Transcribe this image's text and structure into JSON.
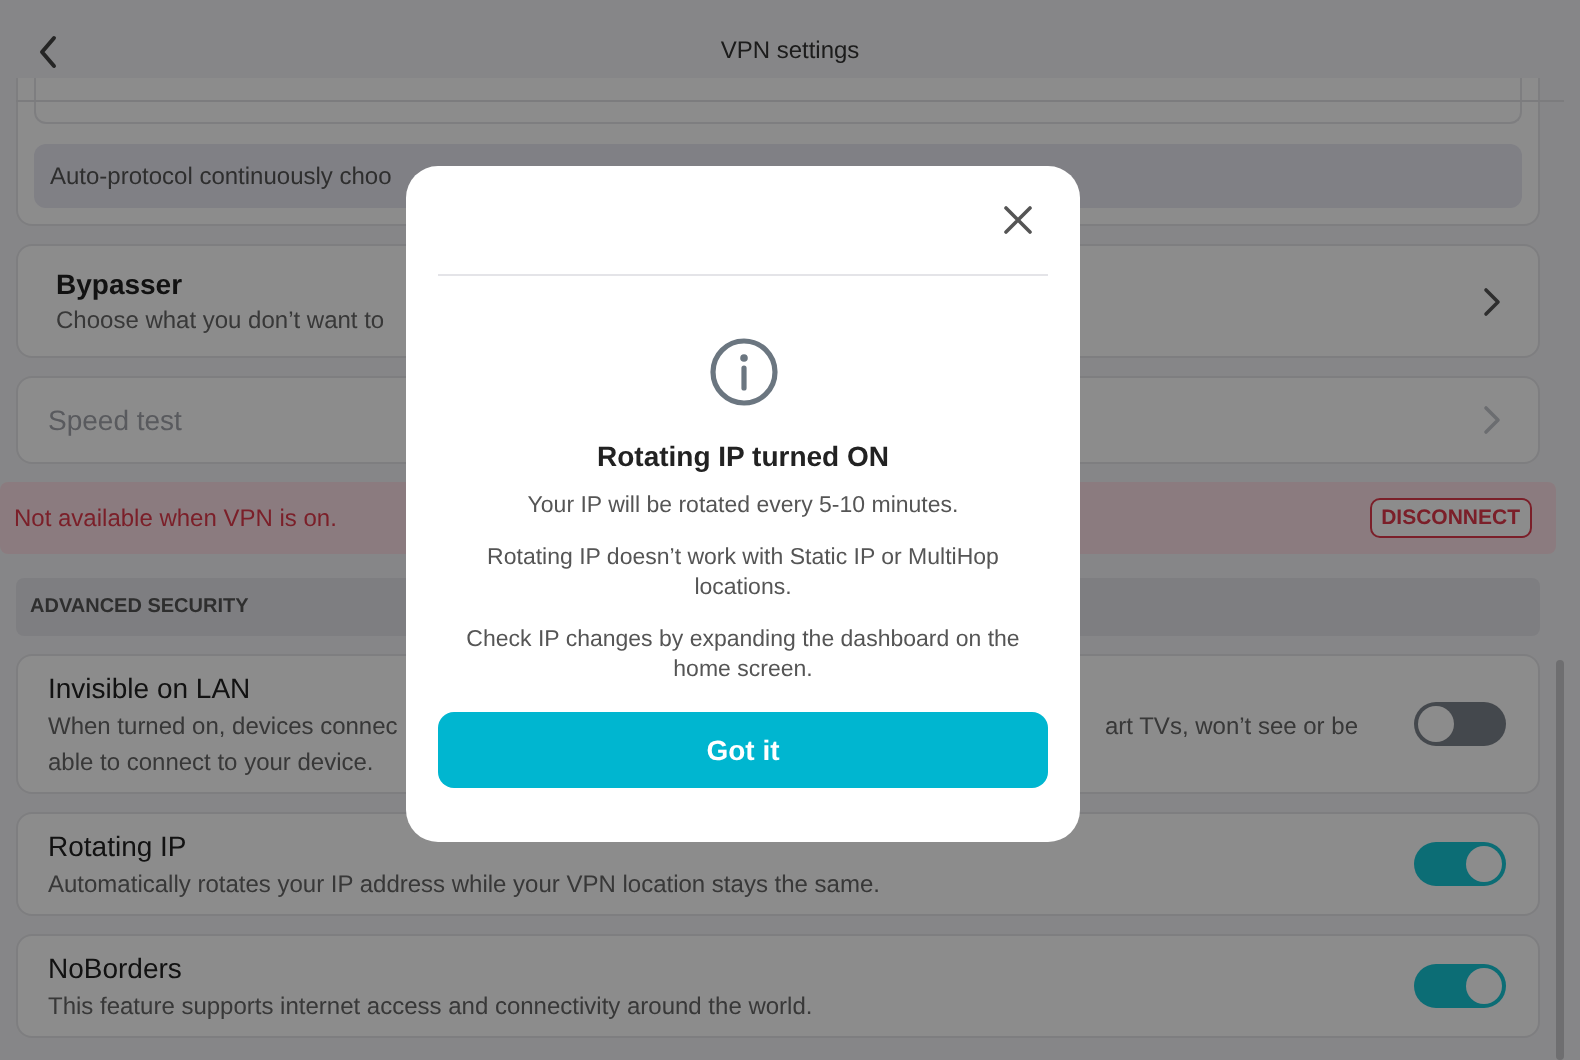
{
  "header": {
    "title": "VPN settings"
  },
  "protocol_note": {
    "text": "Auto-protocol continuously choo"
  },
  "items": [
    {
      "kind": "link",
      "title": "Bypasser",
      "description": "Choose what you don’t want to",
      "disabled": false
    },
    {
      "kind": "link",
      "title": "Speed test",
      "disabled": true
    }
  ],
  "notice": {
    "text": "Not available when VPN is on.",
    "button": "DISCONNECT"
  },
  "section": {
    "title": "ADVANCED SECURITY",
    "settings": [
      {
        "title": "Invisible on LAN",
        "description_lines": [
          [
            "When turned on, devices connec",
            "art TVs, won’t see or be"
          ],
          [
            "able to connect to your device."
          ]
        ],
        "on": false
      },
      {
        "title": "Rotating IP",
        "description_lines": [
          [
            "Automatically rotates your IP address while your VPN location stays the same."
          ]
        ],
        "on": true
      },
      {
        "title": "NoBorders",
        "description_lines": [
          [
            "This feature supports internet access and connectivity around the world."
          ]
        ],
        "on": true
      }
    ]
  },
  "dialog": {
    "title": "Rotating IP turned ON",
    "paragraphs": [
      "Your IP will be rotated every 5-10 minutes.",
      "Rotating IP doesn’t work with Static IP or MultiHop locations.",
      "Check IP changes by expanding the dashboard on the home screen."
    ],
    "button": "Got it"
  }
}
